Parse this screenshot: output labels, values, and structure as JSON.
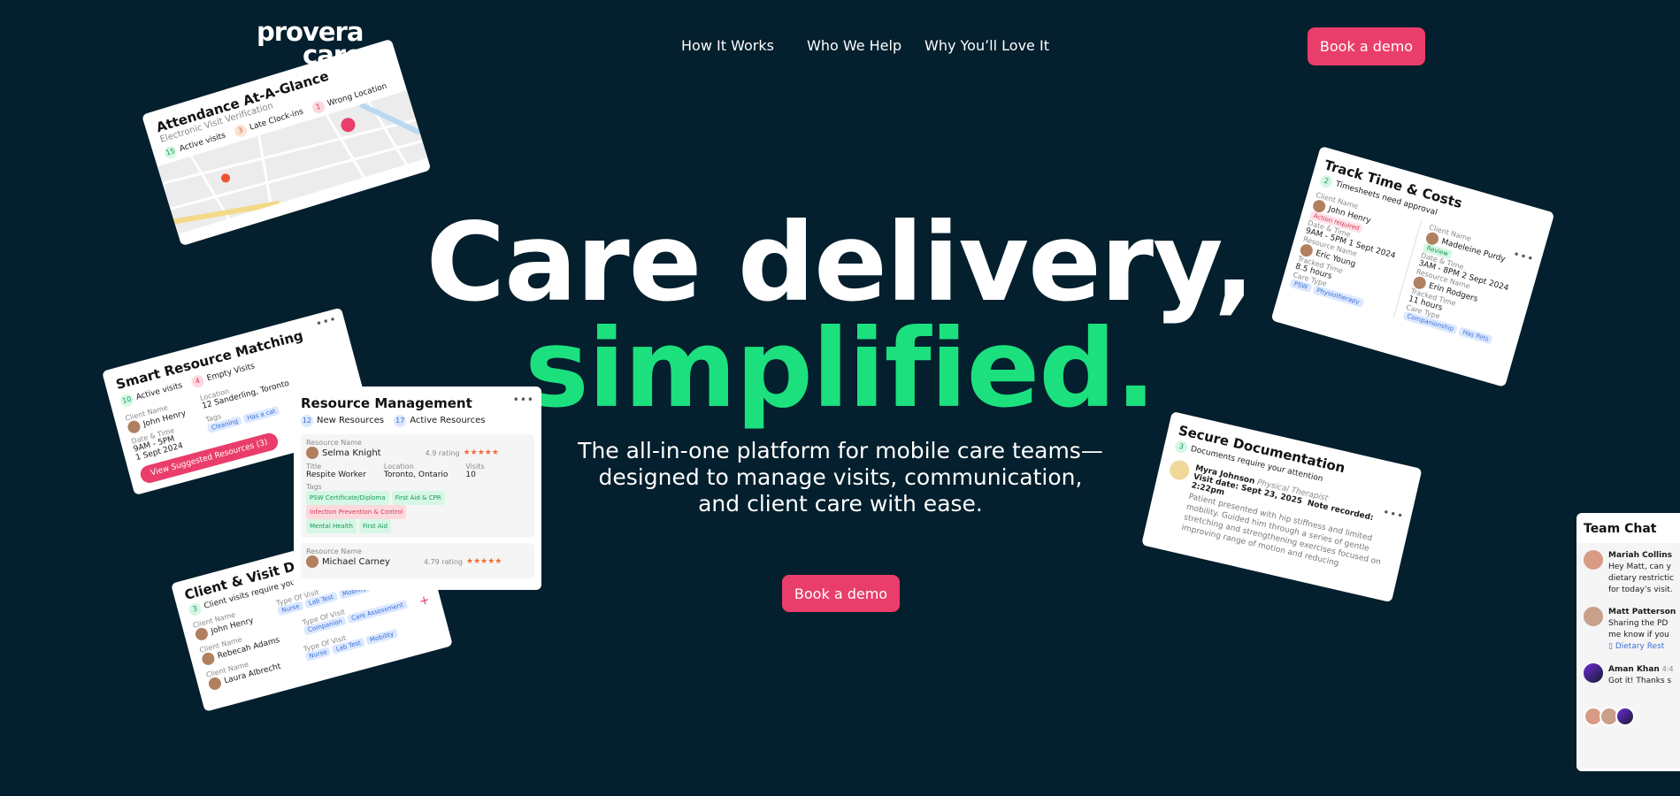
{
  "brand": {
    "line1": "provera",
    "line2": "care",
    "accent": "#1ce07e"
  },
  "nav": {
    "items": [
      "How It Works",
      "Who We Help",
      "Why You’ll Love It"
    ],
    "cta": "Book a demo"
  },
  "hero": {
    "line1": "Care delivery,",
    "line2": "simplified.",
    "subtitle": "The all-in-one platform for mobile care teams—designed to manage visits, communication, and client care with ease.",
    "cta": "Book a demo"
  },
  "attendance": {
    "title": "Attendance At-A-Glance",
    "subtitle": "Electronic Visit Verification",
    "active_n": "15",
    "active": "Active visits",
    "late_n": "3",
    "late": "Late Clock-ins",
    "wrong_n": "1",
    "wrong": "Wrong Location"
  },
  "matching": {
    "title": "Smart Resource Matching",
    "active_n": "10",
    "active": "Active visits",
    "empty_n": "4",
    "empty": "Empty Visits",
    "client_label": "Client Name",
    "client": "John Henry",
    "loc_label": "Location",
    "loc": "12 Sanderling, Toronto",
    "dt_label": "Date & Time",
    "dt": "9AM - 5PM",
    "date": "1 Sept 2024",
    "tags_label": "Tags",
    "tag1": "Cleaning",
    "tag2": "Has a cat",
    "button": "View Suggested Resources (3)"
  },
  "resource": {
    "title": "Resource Management",
    "new_n": "12",
    "new": "New Resources",
    "active_n": "17",
    "active": "Active Resources",
    "name_label": "Resource Name",
    "name1": "Selma Knight",
    "rating1": "4.9 rating",
    "title_label": "Title",
    "title1": "Respite Worker",
    "loc_label": "Location",
    "loc1": "Toronto, Ontario",
    "visits_label": "Visits",
    "visits1": "10",
    "tags_label": "Tags",
    "tags": [
      "PSW Certificate/Diploma",
      "First Aid & CPR",
      "Infection Prevention & Control",
      "Mental Health",
      "First Aid"
    ],
    "name2": "Michael Carney",
    "rating2": "4.79 rating"
  },
  "client_visit": {
    "title": "Client & Visit Dashboard",
    "pending_n": "3",
    "pending": "Client visits require your attention",
    "client_label": "Client Name",
    "type_label": "Type Of Visit",
    "rows": [
      {
        "name": "John Henry",
        "tags": [
          "Nurse",
          "Lab Test",
          "Mobility"
        ]
      },
      {
        "name": "Rebecah Adams",
        "tags": [
          "Companion",
          "Care Assessment"
        ]
      },
      {
        "name": "Laura Albrecht",
        "tags": [
          "Nurse",
          "Lab Test",
          "Mobility"
        ]
      }
    ]
  },
  "track": {
    "title": "Track Time & Costs",
    "pending_n": "2",
    "pending": "Timesheets need approval",
    "client_label": "Client Name",
    "dt_label": "Date & Time",
    "res_label": "Resource Name",
    "tt_label": "Tracked Time",
    "ct_label": "Care Type",
    "left": {
      "client": "John Henry",
      "badge": "Action required",
      "dt": "9AM - 5PM 1 Sept 2024",
      "res": "Eric Young",
      "tt": "8.5 hours",
      "tags": [
        "PSW",
        "Physiotherapy"
      ]
    },
    "right": {
      "client": "Madeleine Purdy",
      "badge": "Review",
      "dt": "3AM - 8PM 2 Sept 2024",
      "res": "Erin Rodgers",
      "tt": "11 hours",
      "tags": [
        "Companionship",
        "Has Pets"
      ]
    }
  },
  "secure": {
    "title": "Secure Documentation",
    "pending_n": "3",
    "pending": "Documents require your attention",
    "name": "Myra Johnson",
    "role": "Physical Therapist",
    "visit": "Visit date: Sept 23, 2025",
    "recorded": "Note recorded: 2:22pm",
    "note": "Patient presented with hip stiffness and limited mobility. Guided him through a series of gentle stretching and strengthening exercises focused on improving range of motion and reducing"
  },
  "chat": {
    "title": "Team Chat",
    "messages": [
      {
        "name": "Mariah Collins",
        "text1": "Hey Matt, can y",
        "text2": "dietary restrictic",
        "text3": "for today’s visit."
      },
      {
        "name": "Matt Patterson",
        "text1": "Sharing the PD",
        "text2": "me know if you",
        "link": "Dietary Rest"
      },
      {
        "name": "Aman Khan",
        "time": "4:4",
        "text1": "Got it! Thanks s"
      }
    ]
  }
}
